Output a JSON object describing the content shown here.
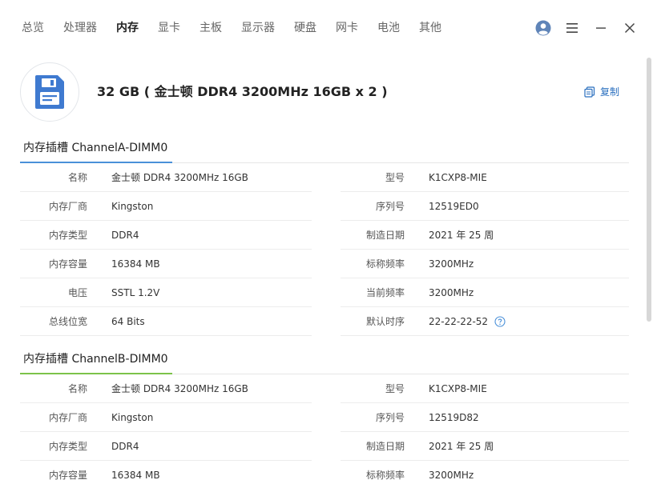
{
  "nav": {
    "items": [
      {
        "label": "总览"
      },
      {
        "label": "处理器"
      },
      {
        "label": "内存",
        "active": true
      },
      {
        "label": "显卡"
      },
      {
        "label": "主板"
      },
      {
        "label": "显示器"
      },
      {
        "label": "硬盘"
      },
      {
        "label": "网卡"
      },
      {
        "label": "电池"
      },
      {
        "label": "其他"
      }
    ]
  },
  "colors": {
    "accent": "#2a6fbf",
    "slot_a_underline": "#4a90d9",
    "slot_b_underline": "#7cc34a"
  },
  "summary": {
    "title": "32 GB ( 金士顿 DDR4 3200MHz 16GB x 2 )",
    "copy_label": "复制"
  },
  "slots": [
    {
      "title": "内存插槽 ChannelA-DIMM0",
      "left": [
        {
          "label": "名称",
          "value": "金士顿 DDR4 3200MHz 16GB"
        },
        {
          "label": "内存厂商",
          "value": "Kingston"
        },
        {
          "label": "内存类型",
          "value": "DDR4"
        },
        {
          "label": "内存容量",
          "value": "16384 MB"
        },
        {
          "label": "电压",
          "value": "SSTL 1.2V"
        },
        {
          "label": "总线位宽",
          "value": "64 Bits"
        }
      ],
      "right": [
        {
          "label": "型号",
          "value": "K1CXP8-MIE"
        },
        {
          "label": "序列号",
          "value": "12519ED0"
        },
        {
          "label": "制造日期",
          "value": "2021 年 25 周"
        },
        {
          "label": "标称频率",
          "value": "3200MHz"
        },
        {
          "label": "当前频率",
          "value": "3200MHz"
        },
        {
          "label": "默认时序",
          "value": "22-22-22-52"
        }
      ]
    },
    {
      "title": "内存插槽 ChannelB-DIMM0",
      "left": [
        {
          "label": "名称",
          "value": "金士顿 DDR4 3200MHz 16GB"
        },
        {
          "label": "内存厂商",
          "value": "Kingston"
        },
        {
          "label": "内存类型",
          "value": "DDR4"
        },
        {
          "label": "内存容量",
          "value": "16384 MB"
        }
      ],
      "right": [
        {
          "label": "型号",
          "value": "K1CXP8-MIE"
        },
        {
          "label": "序列号",
          "value": "12519D82"
        },
        {
          "label": "制造日期",
          "value": "2021 年 25 周"
        },
        {
          "label": "标称频率",
          "value": "3200MHz"
        }
      ]
    }
  ]
}
